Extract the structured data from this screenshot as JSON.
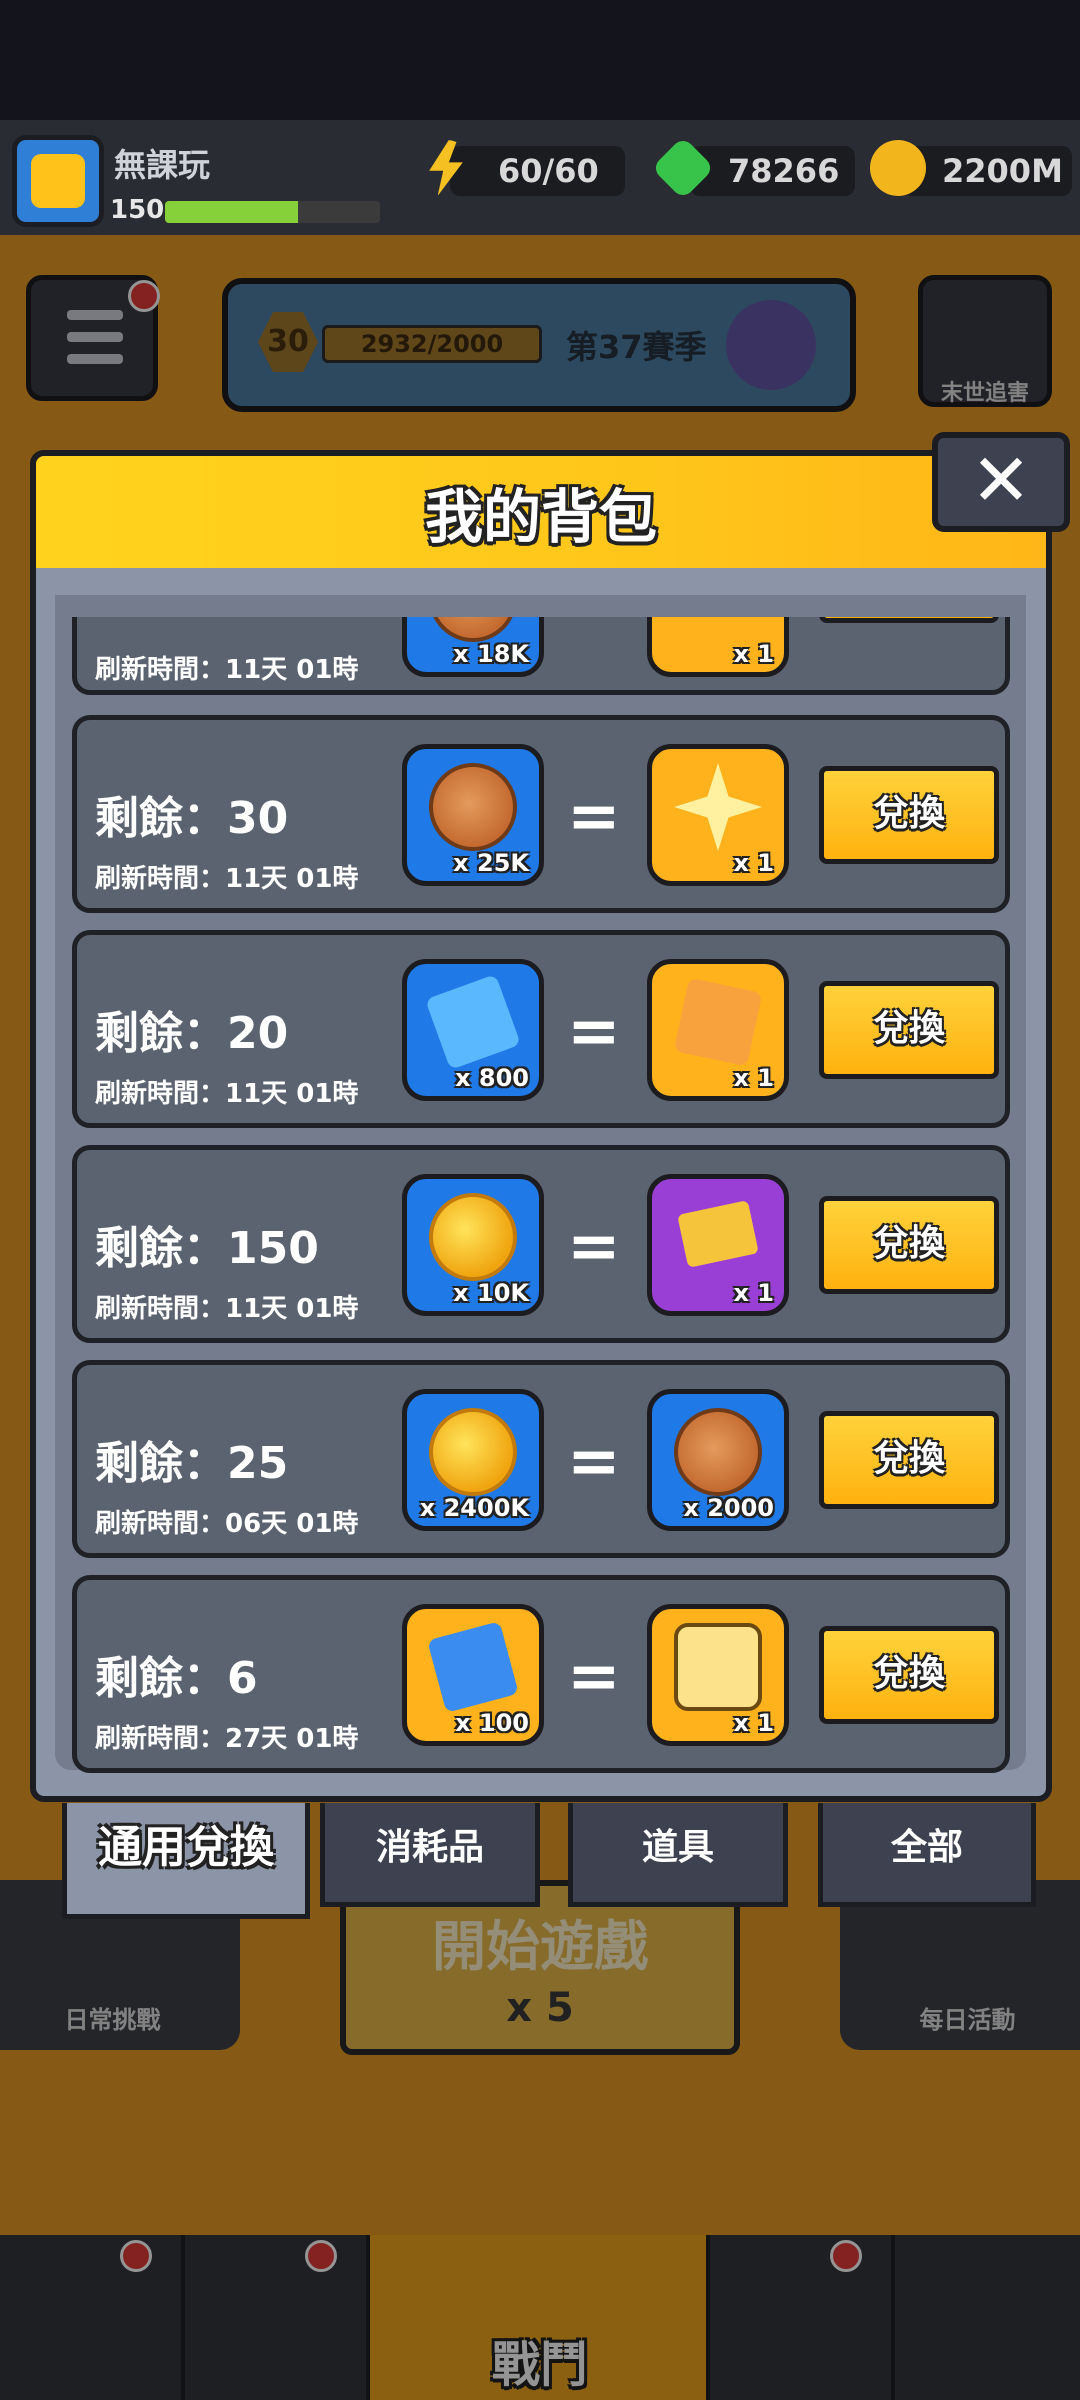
{
  "topbar": {
    "username": "無課玩",
    "level": "150",
    "exp_fraction": 0.62,
    "energy": "60/60",
    "gems": "78266",
    "coins": "2200M"
  },
  "lobby": {
    "season_level": "30",
    "season_progress": "2932/2000",
    "season_name": "第37賽季",
    "doom_label": "末世追害",
    "start_label": "開始遊戲",
    "start_cost": "x 5",
    "daily_label": "日常挑戰",
    "event_label": "每日活動",
    "battle_label": "戰鬥"
  },
  "modal": {
    "title": "我的背包",
    "close_symbol": "✕",
    "partial_row": {
      "refresh": "刷新時間：11天 01時",
      "cost_qty": "x 18K",
      "reward_qty": "x 1"
    },
    "rows": [
      {
        "remaining": "剩餘：30",
        "refresh": "刷新時間：11天 01時",
        "cost_qty": "x 25K",
        "reward_qty": "x 1",
        "redeem": "兌換"
      },
      {
        "remaining": "剩餘：20",
        "refresh": "刷新時間：11天 01時",
        "cost_qty": "x 800",
        "reward_qty": "x 1",
        "redeem": "兌換"
      },
      {
        "remaining": "剩餘：150",
        "refresh": "刷新時間：11天 01時",
        "cost_qty": "x 10K",
        "reward_qty": "x 1",
        "redeem": "兌換"
      },
      {
        "remaining": "剩餘：25",
        "refresh": "刷新時間：06天 01時",
        "cost_qty": "x 2400K",
        "reward_qty": "x 2000",
        "redeem": "兌換"
      },
      {
        "remaining": "剩餘：6",
        "refresh": "刷新時間：27天 01時",
        "cost_qty": "x 100",
        "reward_qty": "x 1",
        "redeem": "兌換"
      }
    ],
    "equals": "=",
    "tabs": [
      "通用兌換",
      "消耗品",
      "道具",
      "全部"
    ]
  },
  "icons": {
    "cost": [
      "cookie-icon",
      "puzzle-piece-icon",
      "gold-coin-icon",
      "gold-coin-icon",
      "sp-puzzle-icon"
    ],
    "reward": [
      "star-shard-icon",
      "s-hero-puzzle-icon",
      "purple-ticket-icon",
      "cookie-icon",
      "treasure-chest-icon"
    ]
  },
  "colors": {
    "header": "#ffd31d",
    "redeem_button": "#ffc21a",
    "tile_blue": "#1f79e6",
    "tile_gold": "#ffb21b",
    "tile_purple": "#9a3fd6"
  }
}
